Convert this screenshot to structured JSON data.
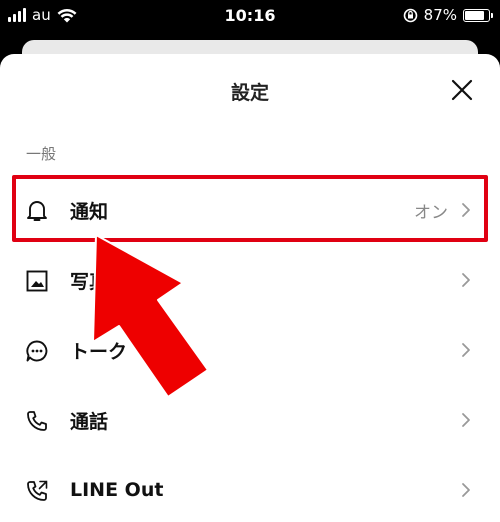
{
  "status_bar": {
    "carrier": "au",
    "time": "10:16",
    "battery_percent": "87%",
    "battery_level": 0.87,
    "icons": [
      "signal-icon",
      "wifi-icon",
      "rotation-lock-icon",
      "battery-icon"
    ]
  },
  "sheet": {
    "title": "設定",
    "close_icon": "close-icon"
  },
  "section": {
    "label": "一般"
  },
  "rows": [
    {
      "label": "通知",
      "value": "オン",
      "icon": "bell-icon"
    },
    {
      "label": "写真と動画",
      "value": "",
      "icon": "photo-icon"
    },
    {
      "label": "トーク",
      "value": "",
      "icon": "chat-bubble-icon"
    },
    {
      "label": "通話",
      "value": "",
      "icon": "phone-icon"
    },
    {
      "label": "LINE Out",
      "value": "",
      "icon": "phone-out-icon"
    }
  ],
  "colors": {
    "highlight": "#e00012",
    "arrow": "#ee0000",
    "sheet_bg": "#ffffff",
    "backdrop": "#000000"
  }
}
